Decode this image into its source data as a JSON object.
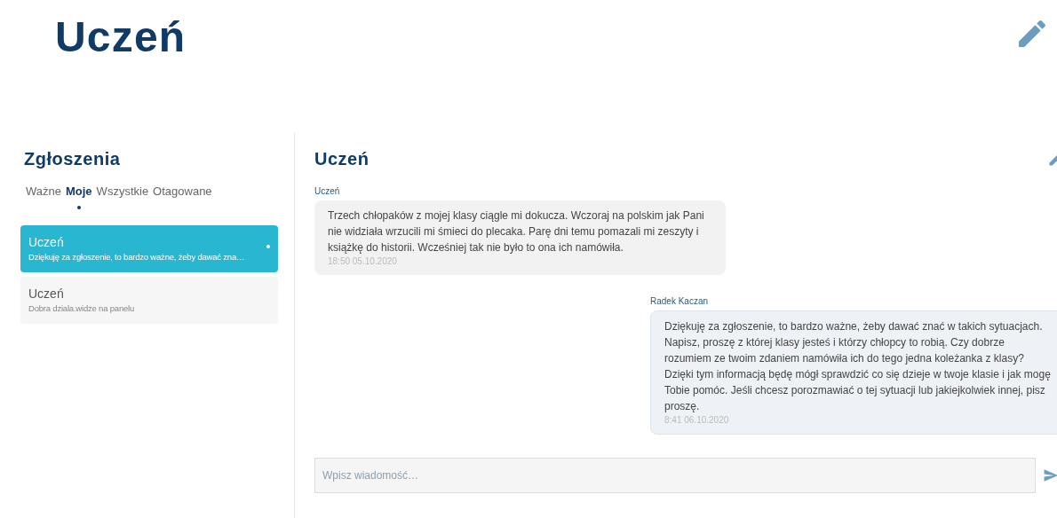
{
  "header": {
    "title": "Uczeń"
  },
  "sidebar": {
    "title": "Zgłoszenia",
    "tabs": [
      {
        "label": "Ważne",
        "selected": false
      },
      {
        "label": "Moje",
        "selected": true
      },
      {
        "label": "Wszystkie",
        "selected": false
      },
      {
        "label": "Otagowane",
        "selected": false
      }
    ],
    "conversations": [
      {
        "name": "Uczeń",
        "preview": "Dziękuję za zgłoszenie, to bardzo ważne, żeby dawać zna…",
        "selected": true,
        "unread": true
      },
      {
        "name": "Uczeń",
        "preview": "Dobra dziala.widze na panelu",
        "selected": false,
        "unread": false
      }
    ]
  },
  "chat": {
    "title": "Uczeń",
    "messages": [
      {
        "kind": "received",
        "sender": "Uczeń",
        "text": "Trzech chłopaków z mojej klasy ciągle mi dokucza. Wczoraj na polskim jak Pani nie widziała wrzucili mi śmieci do plecaka. Parę dni temu pomazali mi zeszyty i książkę do historii. Wcześniej tak nie było to ona ich namówiła.",
        "time": "18:50 05.10.2020"
      },
      {
        "kind": "sent",
        "sender": "Radek Kaczan",
        "text": "Dziękuję za zgłoszenie, to bardzo ważne, żeby dawać znać w takich sytuacjach. Napisz, proszę z której klasy jesteś i którzy chłopcy to robią. Czy dobrze rozumiem ze twoim zdaniem namówiła ich do tego jedna koleżanka z klasy? Dzięki tym informacją będę mógł sprawdzić co się dzieje w twoje klasie i jak mogę Tobie pomóc. Jeśli chcesz porozmawiać o tej sytuacji lub jakiejkolwiek innej, pisz proszę.",
        "time": "8:41 06.10.2020"
      }
    ],
    "input": {
      "placeholder": "Wpisz wiadomość…"
    }
  }
}
